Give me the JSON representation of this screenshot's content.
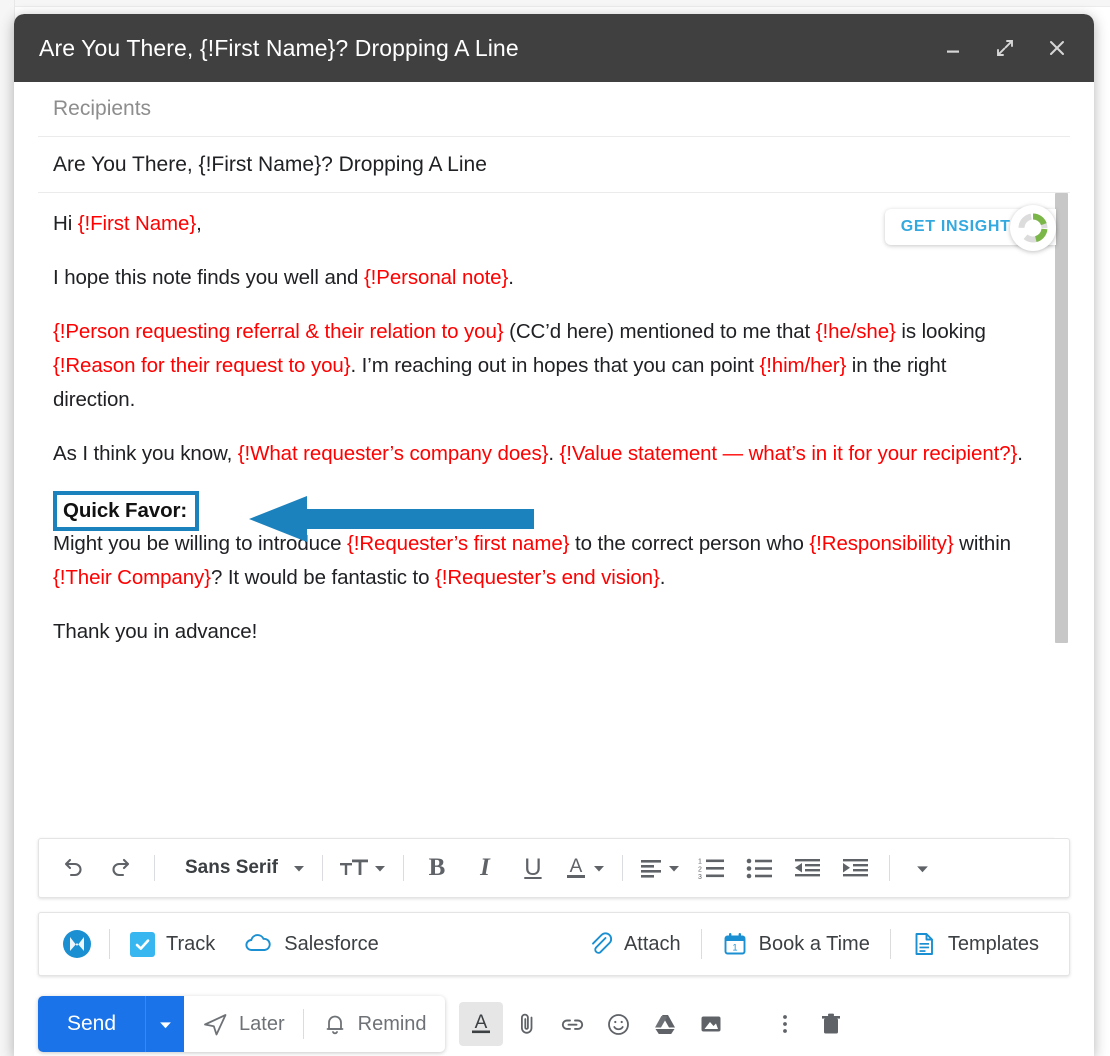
{
  "window": {
    "title": "Are You There, {!First Name}? Dropping A Line",
    "controls": [
      {
        "name": "minimize-button",
        "icon": "minimize-icon"
      },
      {
        "name": "expand-button",
        "icon": "expand-icon"
      },
      {
        "name": "close-button",
        "icon": "close-icon"
      }
    ]
  },
  "fields": {
    "recipients_placeholder": "Recipients",
    "recipients_value": "Recipients",
    "subject_value": "Are You There, {!First Name}? Dropping A Line"
  },
  "insights": {
    "label": "GET INSIGHTS",
    "accent_color": "#34a9e0",
    "donut_color": "#7ab648"
  },
  "body": {
    "greeting_prefix": "Hi ",
    "greeting_field": "{!First Name}",
    "greeting_suffix": ",",
    "p2_prefix": "I hope this note finds you well and ",
    "p2_field": "{!Personal note}",
    "p2_suffix": ".",
    "p3_field1": "{!Person requesting referral & their relation to you}",
    "p3_text1": " (CC’d here) mentioned to me that ",
    "p3_field2": "{!he/she}",
    "p3_text2": " is looking ",
    "p3_field3": "{!Reason for their request to you}",
    "p3_text3": ". I’m reaching out in hopes that you can point ",
    "p3_field4": "{!him/her}",
    "p3_text4": " in the right direction.",
    "p4_text1": "As I think you know, ",
    "p4_field1": "{!What requester’s company does}",
    "p4_text2": ". ",
    "p4_field2": "{!Value statement — what’s in it for your recipient?}",
    "p4_text3": ".",
    "quick_favor_label": "Quick Favor:",
    "p5_text1": "Might you be willing to introduce ",
    "p5_field1": "{!Requester’s first name}",
    "p5_text2": " to the correct person who ",
    "p5_field2": "{!Responsibility}",
    "p5_text3": " within ",
    "p5_field3": "{!Their Company}",
    "p5_text4": "? It would be fantastic to ",
    "p5_field4": "{!Requester’s end vision}",
    "p5_text5": ".",
    "p6_text": "Thank you in advance!",
    "merge_field_color": "#ff0000",
    "annotation_color": "#1b82bd"
  },
  "format_toolbar": {
    "items": [
      {
        "name": "undo-button",
        "icon": "undo-icon",
        "label": ""
      },
      {
        "name": "redo-button",
        "icon": "redo-icon",
        "label": ""
      },
      {
        "name": "font-family-dropdown",
        "icon": "chevron-down-icon",
        "label": "Sans Serif"
      },
      {
        "name": "font-size-dropdown",
        "icon": "text-size-icon",
        "label": ""
      },
      {
        "name": "bold-button",
        "icon": "bold-icon",
        "label": "B"
      },
      {
        "name": "italic-button",
        "icon": "italic-icon",
        "label": "I"
      },
      {
        "name": "underline-button",
        "icon": "underline-icon",
        "label": "U"
      },
      {
        "name": "text-color-dropdown",
        "icon": "text-color-icon",
        "label": "A"
      },
      {
        "name": "align-dropdown",
        "icon": "align-left-icon",
        "label": ""
      },
      {
        "name": "numbered-list-button",
        "icon": "numbered-list-icon",
        "label": ""
      },
      {
        "name": "bulleted-list-button",
        "icon": "bulleted-list-icon",
        "label": ""
      },
      {
        "name": "decrease-indent-button",
        "icon": "decrease-indent-icon",
        "label": ""
      },
      {
        "name": "increase-indent-button",
        "icon": "increase-indent-icon",
        "label": ""
      },
      {
        "name": "more-format-options-button",
        "icon": "chevron-down-icon",
        "label": ""
      }
    ],
    "font_family_value": "Sans Serif"
  },
  "plugin_bar": {
    "logo_name": "yesware-logo",
    "track_label": "Track",
    "track_checked": true,
    "salesforce_label": "Salesforce",
    "attach_label": "Attach",
    "book_a_time_label": "Book a Time",
    "templates_label": "Templates",
    "accent_color": "#1a8fd1"
  },
  "send_bar": {
    "send_label": "Send",
    "later_label": "Later",
    "remind_label": "Remind",
    "send_color": "#1a73e8",
    "tools": [
      {
        "name": "formatting-options-button",
        "icon": "text-format-icon",
        "active": true
      },
      {
        "name": "attach-file-button",
        "icon": "paperclip-icon",
        "active": false
      },
      {
        "name": "insert-link-button",
        "icon": "link-icon",
        "active": false
      },
      {
        "name": "insert-emoji-button",
        "icon": "emoji-icon",
        "active": false
      },
      {
        "name": "insert-drive-file-button",
        "icon": "google-drive-icon",
        "active": false
      },
      {
        "name": "insert-photo-button",
        "icon": "image-icon",
        "active": false
      },
      {
        "name": "more-options-button",
        "icon": "kebab-menu-icon",
        "active": false
      },
      {
        "name": "discard-draft-button",
        "icon": "trash-icon",
        "active": false
      }
    ]
  }
}
